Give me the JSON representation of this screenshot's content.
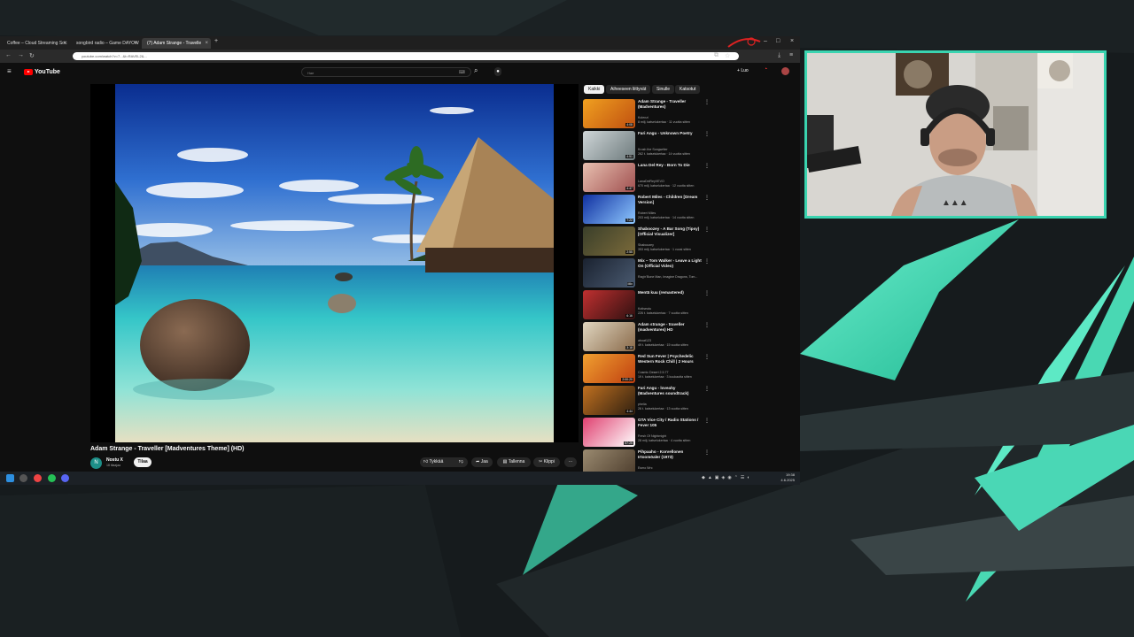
{
  "browser": {
    "tabs": [
      {
        "label": "Coffee – Cloud Streaming Soc",
        "close": "×"
      },
      {
        "label": "songbird radio – Game DAYOW",
        "close": "×"
      },
      {
        "label": "(7) Adam Strange - Travelle",
        "close": "×"
      }
    ],
    "new_tab": "+",
    "url": "youtube.com/watch?v=7...&t=RAVEL2&...",
    "window_controls": [
      "–",
      "□",
      "×"
    ]
  },
  "youtube": {
    "logo": "YouTube",
    "search_placeholder": "Hae",
    "create_label": "Luo",
    "video_title": "Adam Strange - Traveller [Madventures Theme] (HD)",
    "channel_name": "Nostu X",
    "channel_subs": "18 tilaajaa",
    "channel_initial": "N",
    "subscribe_label": "Tilaa",
    "actions": {
      "like": "Tykkää",
      "share": "Jaa",
      "save": "Tallenna",
      "clip": "Klippi",
      "more": "···"
    },
    "chips": [
      "Kaikki",
      "Aiheeseen liittyvät",
      "Sinulle",
      "Katsotut"
    ],
    "recommendations": [
      {
        "title": "Adam Strange - Traveller (Madventures)",
        "channel": "Kolenzi",
        "meta": "8 milj. katselukertaa · 11 vuotta sitten",
        "duration": "4:08",
        "thumb": "madventures"
      },
      {
        "title": "Fari Angu - Unknown Poetry",
        "channel": "Krosh the Songwriter",
        "meta": "262 t. katselukertaa · 14 vuotta sitten",
        "duration": "4:51",
        "thumb": "poetry"
      },
      {
        "title": "Lana Del Rey - Born To Die",
        "channel": "LanaDelReyVEVO",
        "meta": "670 milj. katselukertaa · 12 vuotta sitten",
        "duration": "4:47",
        "thumb": "lana"
      },
      {
        "title": "Robert Miles - Children [Dream Version]",
        "channel": "Robert Miles",
        "meta": "203 milj. katselukertaa · 14 vuotta sitten",
        "duration": "7:22",
        "thumb": "miles"
      },
      {
        "title": "Shaboozey - A Bar Song (Tipsy) [Official Visualizer]",
        "channel": "Shaboozey",
        "meta": "353 milj. katselukertaa · 1 vuosi sitten",
        "duration": "2:55",
        "thumb": "shaboozey"
      },
      {
        "title": "Mix – Tom Walker - Leave a Light On (Official Video)",
        "channel": "Rag'n'Bone Man, Imagine Dragons, Tom...",
        "meta": "",
        "duration": "Mix",
        "thumb": "mix"
      },
      {
        "title": "Mentä kuu (remastered)",
        "channel": "Kotiseutu",
        "meta": "226 t. katselukertaa · 7 vuotta sitten",
        "duration": "6:16",
        "thumb": "mentaku"
      },
      {
        "title": "Adam strange - traveller (madventures) HD",
        "channel": "aboat123",
        "meta": "49 t. katselukertaa · 15 vuotta sitten",
        "duration": "3:18",
        "thumb": "traveller"
      },
      {
        "title": "Red Sun Fever | Psychedelic Western Rock Chill | 2 Hours",
        "channel": "Cosmic Desert 2.5.77",
        "meta": "19 t. katselukertaa · 3 kuukautta sitten",
        "duration": "2:00:20",
        "thumb": "redsun"
      },
      {
        "title": "Fari Angu - loveahy (Madventures soundtrack)",
        "channel": "phelia",
        "meta": "26 t. katselukertaa · 13 vuotta sitten",
        "duration": "4:44",
        "thumb": "loveahy"
      },
      {
        "title": "GTA Vice City / Radio Stations / Fever 105",
        "channel": "Fresh Of Nightmight",
        "meta": "28 milj. katselukertaa · 4 vuotta sitten",
        "duration": "57:25",
        "thumb": "gta"
      },
      {
        "title": "Pihpaaho - Korvellonen Irtoomöaler (1973)",
        "channel": "Esmo Wrc",
        "meta": "",
        "duration": "",
        "thumb": "pihpaaho"
      }
    ]
  },
  "taskbar": {
    "time": "19:38",
    "date": "4.6.2025"
  },
  "colors": {
    "accent": "#3ad4b0",
    "yt_red": "#ff0000",
    "background": "#15191b"
  }
}
